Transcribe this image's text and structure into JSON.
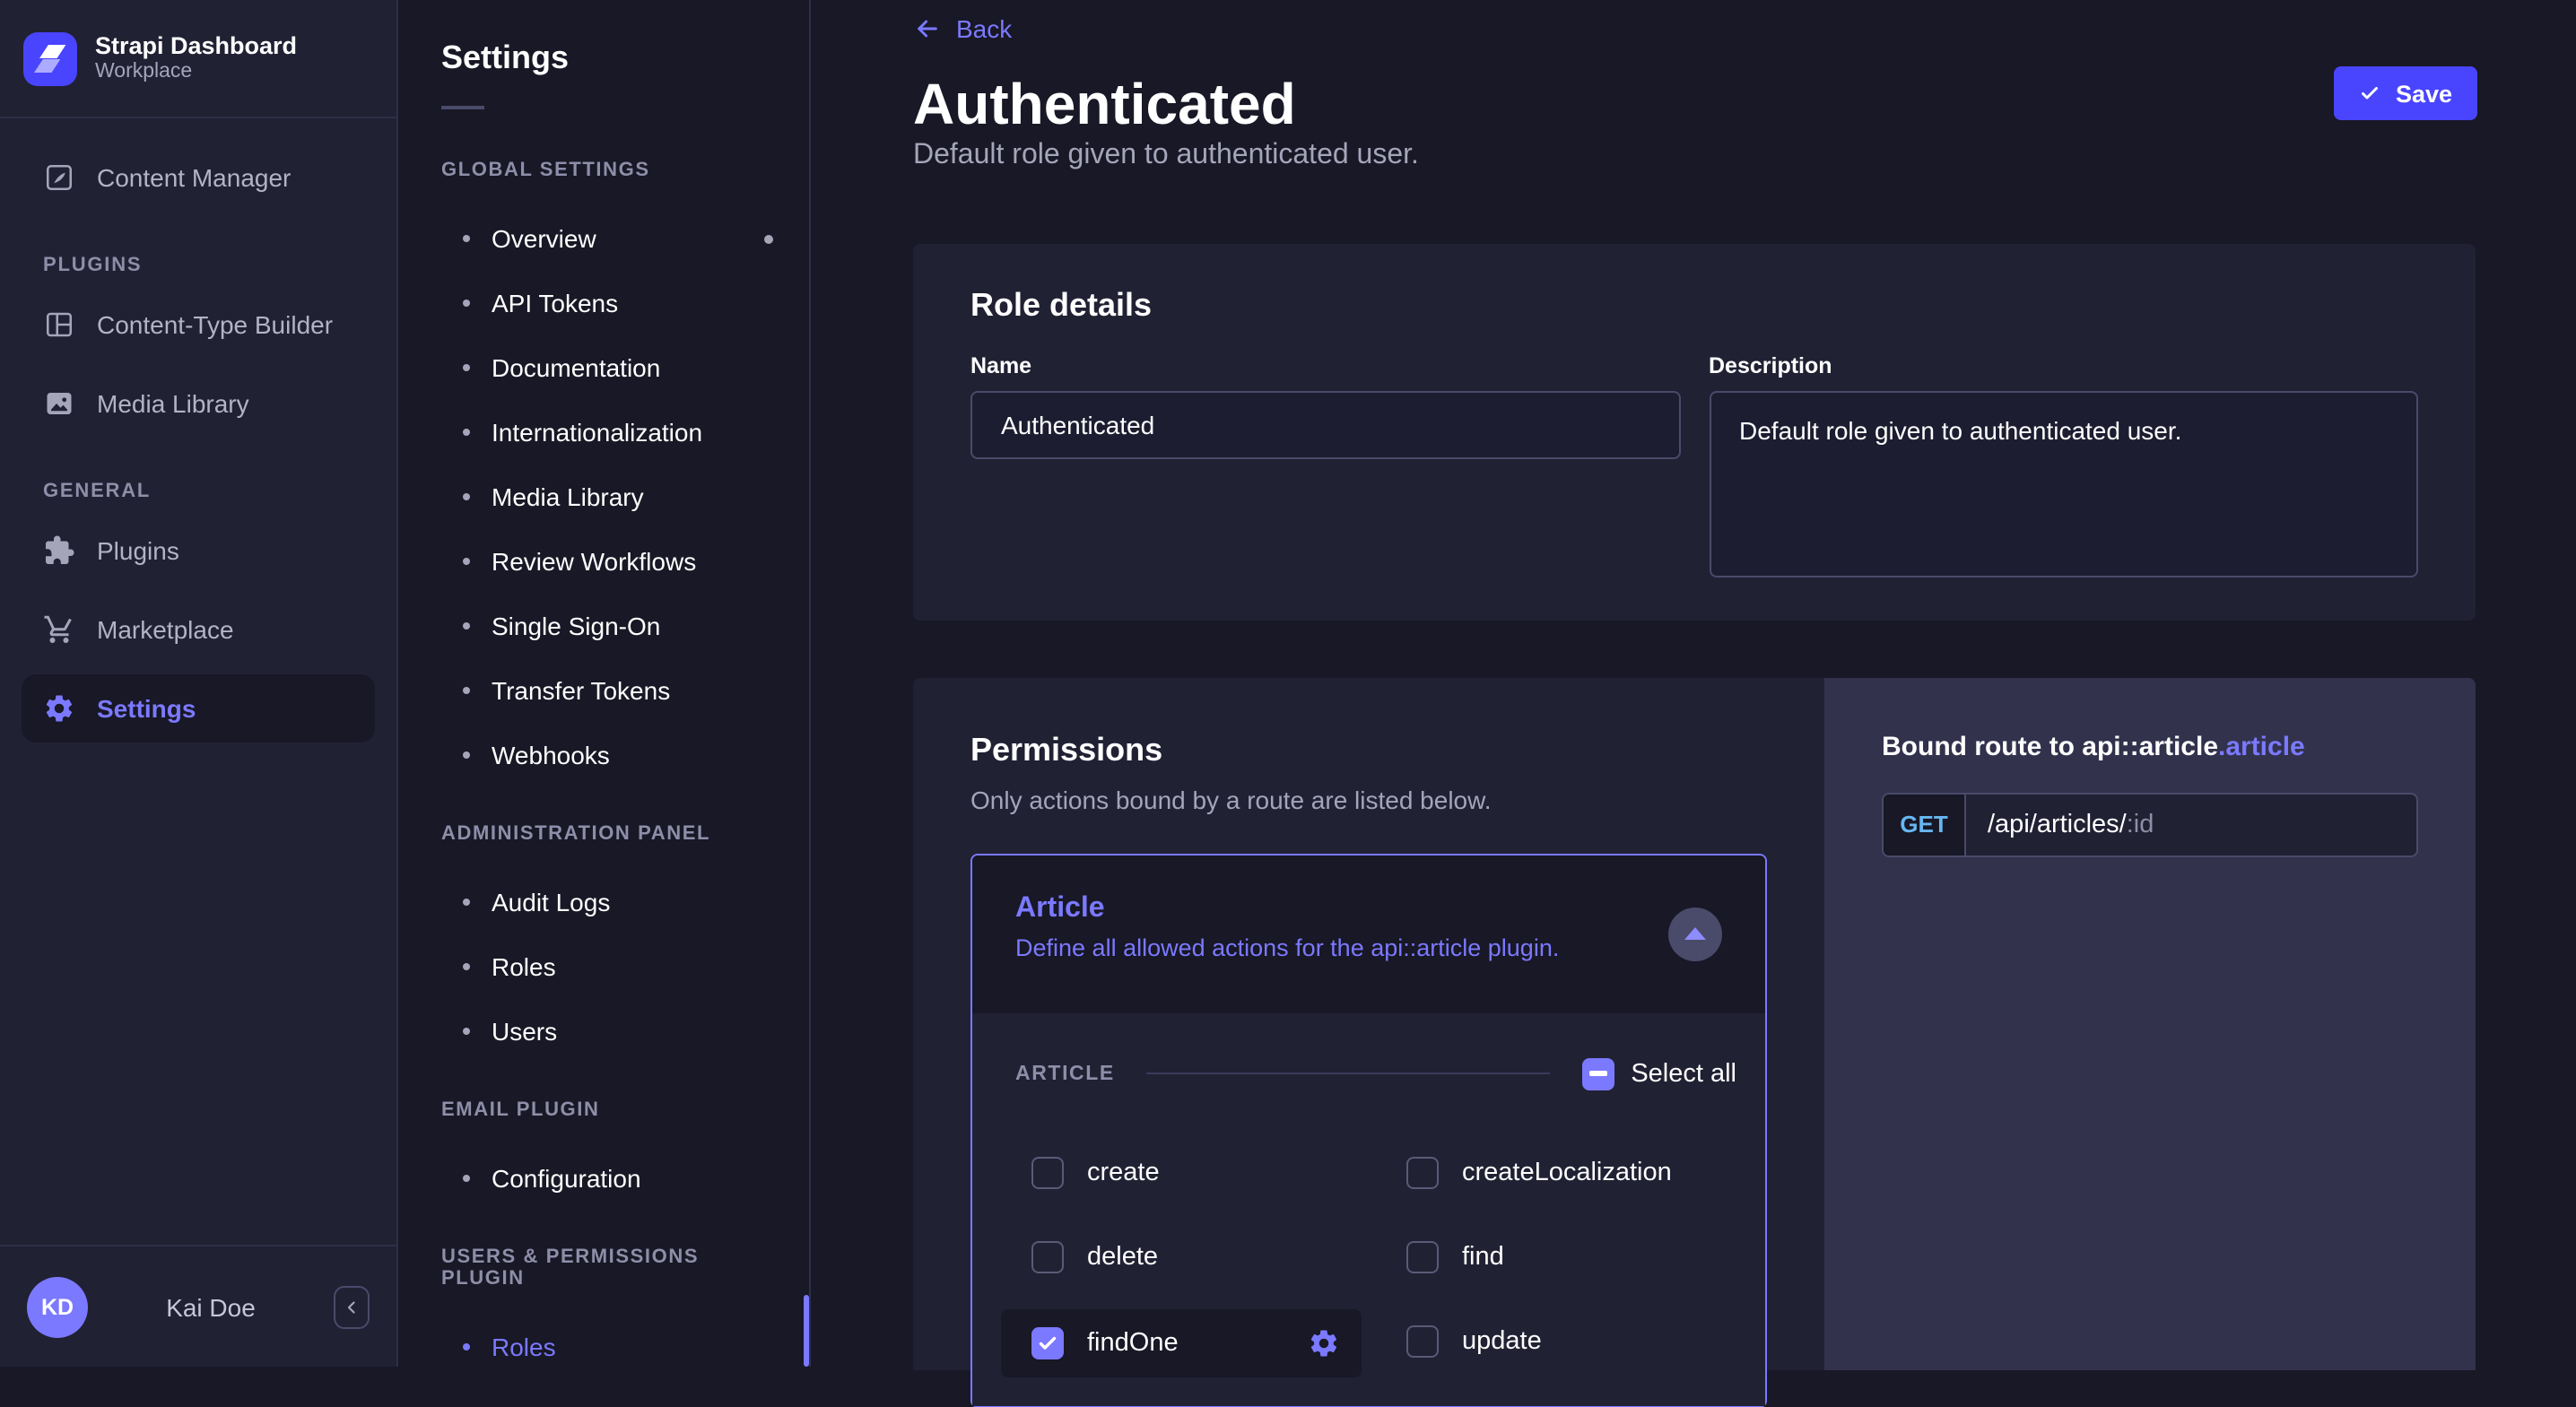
{
  "brand": {
    "title": "Strapi Dashboard",
    "subtitle": "Workplace"
  },
  "user": {
    "initials": "KD",
    "name": "Kai Doe"
  },
  "nav": {
    "content_manager": "Content Manager",
    "sections": [
      {
        "title": "PLUGINS",
        "items": [
          {
            "label": "Content-Type Builder"
          },
          {
            "label": "Media Library"
          }
        ]
      },
      {
        "title": "GENERAL",
        "items": [
          {
            "label": "Plugins"
          },
          {
            "label": "Marketplace"
          },
          {
            "label": "Settings"
          }
        ]
      }
    ]
  },
  "subnav": {
    "title": "Settings",
    "sections": [
      {
        "title": "GLOBAL SETTINGS",
        "items": [
          {
            "label": "Overview"
          },
          {
            "label": "API Tokens"
          },
          {
            "label": "Documentation"
          },
          {
            "label": "Internationalization"
          },
          {
            "label": "Media Library"
          },
          {
            "label": "Review Workflows"
          },
          {
            "label": "Single Sign-On"
          },
          {
            "label": "Transfer Tokens"
          },
          {
            "label": "Webhooks"
          }
        ]
      },
      {
        "title": "ADMINISTRATION PANEL",
        "items": [
          {
            "label": "Audit Logs"
          },
          {
            "label": "Roles"
          },
          {
            "label": "Users"
          }
        ]
      },
      {
        "title": "EMAIL PLUGIN",
        "items": [
          {
            "label": "Configuration"
          }
        ]
      },
      {
        "title": "USERS & PERMISSIONS PLUGIN",
        "items": [
          {
            "label": "Roles"
          }
        ]
      }
    ]
  },
  "header": {
    "back_label": "Back",
    "title": "Authenticated",
    "subtitle": "Default role given to authenticated user.",
    "save_label": "Save"
  },
  "role_details": {
    "title": "Role details",
    "name_label": "Name",
    "name_value": "Authenticated",
    "description_label": "Description",
    "description_value": "Default role given to authenticated user."
  },
  "permissions": {
    "title": "Permissions",
    "subtitle": "Only actions bound by a route are listed below.",
    "accordion_title": "Article",
    "accordion_description": "Define all allowed actions for the api::article plugin.",
    "group_label": "ARTICLE",
    "select_all_label": "Select all",
    "actions": [
      {
        "label": "create",
        "checked": false
      },
      {
        "label": "createLocalization",
        "checked": false
      },
      {
        "label": "delete",
        "checked": false
      },
      {
        "label": "find",
        "checked": false
      },
      {
        "label": "findOne",
        "checked": true,
        "selected": true
      },
      {
        "label": "update",
        "checked": false
      }
    ]
  },
  "bound_route": {
    "title": "Bound route to api::article",
    "title_accent": ".article",
    "method": "GET",
    "path": "/api/articles/",
    "param": ":id"
  },
  "colors": {
    "accent": "#4945ff",
    "accent_light": "#7b79ff",
    "page_bg": "#181826",
    "card_bg": "#212134",
    "panel_bg": "#32324d",
    "method_get": "#66b7f1"
  }
}
